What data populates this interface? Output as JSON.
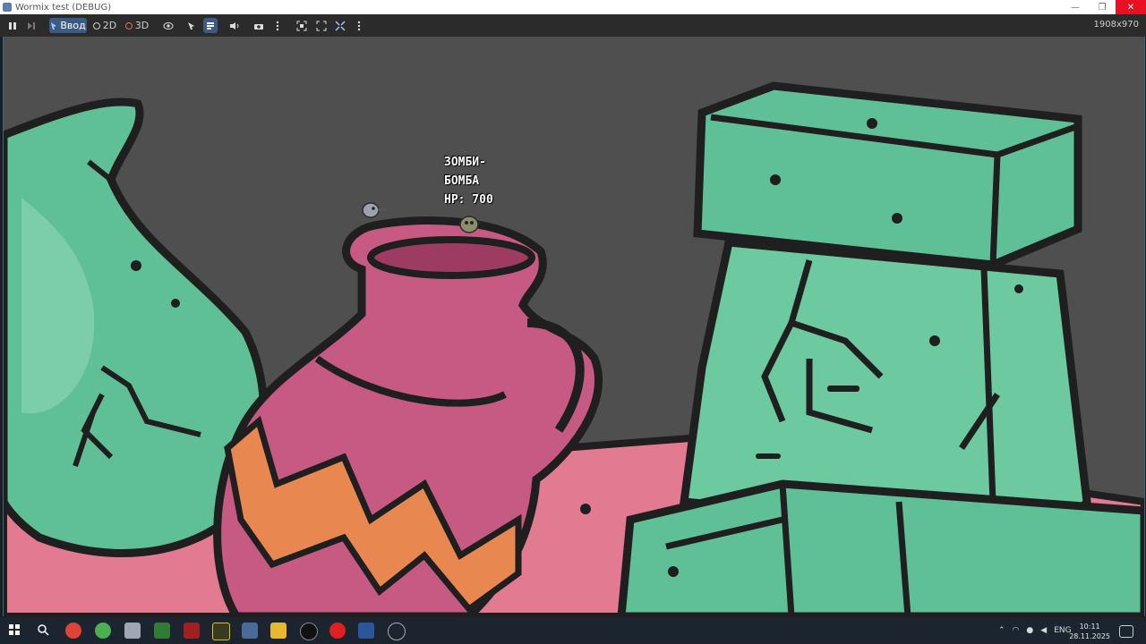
{
  "window": {
    "title": "Wormix test (DEBUG)",
    "minimize": "—",
    "restore": "❐",
    "close": "✕"
  },
  "toolbar": {
    "pause_icon": "pause-icon",
    "step_icon": "step-icon",
    "input_label": "Ввод",
    "mode_2d": "2D",
    "mode_3d": "3D",
    "resolution": "1908x970"
  },
  "game": {
    "unit_name_line1": "ЗОМБИ-",
    "unit_name_line2": "БОМБА",
    "unit_hp": "HP: 700"
  },
  "taskbar": {
    "lang": "ENG",
    "time": "10:11",
    "date": "28.11.2025"
  },
  "colors": {
    "toolbar_active": "#3d5a85",
    "viewport_bg": "#4f4f4f",
    "green_vase": "#5fbf96",
    "pink_jug": "#c75a82",
    "orange_zigzag": "#e8874f",
    "pink_floor": "#e27a92"
  }
}
